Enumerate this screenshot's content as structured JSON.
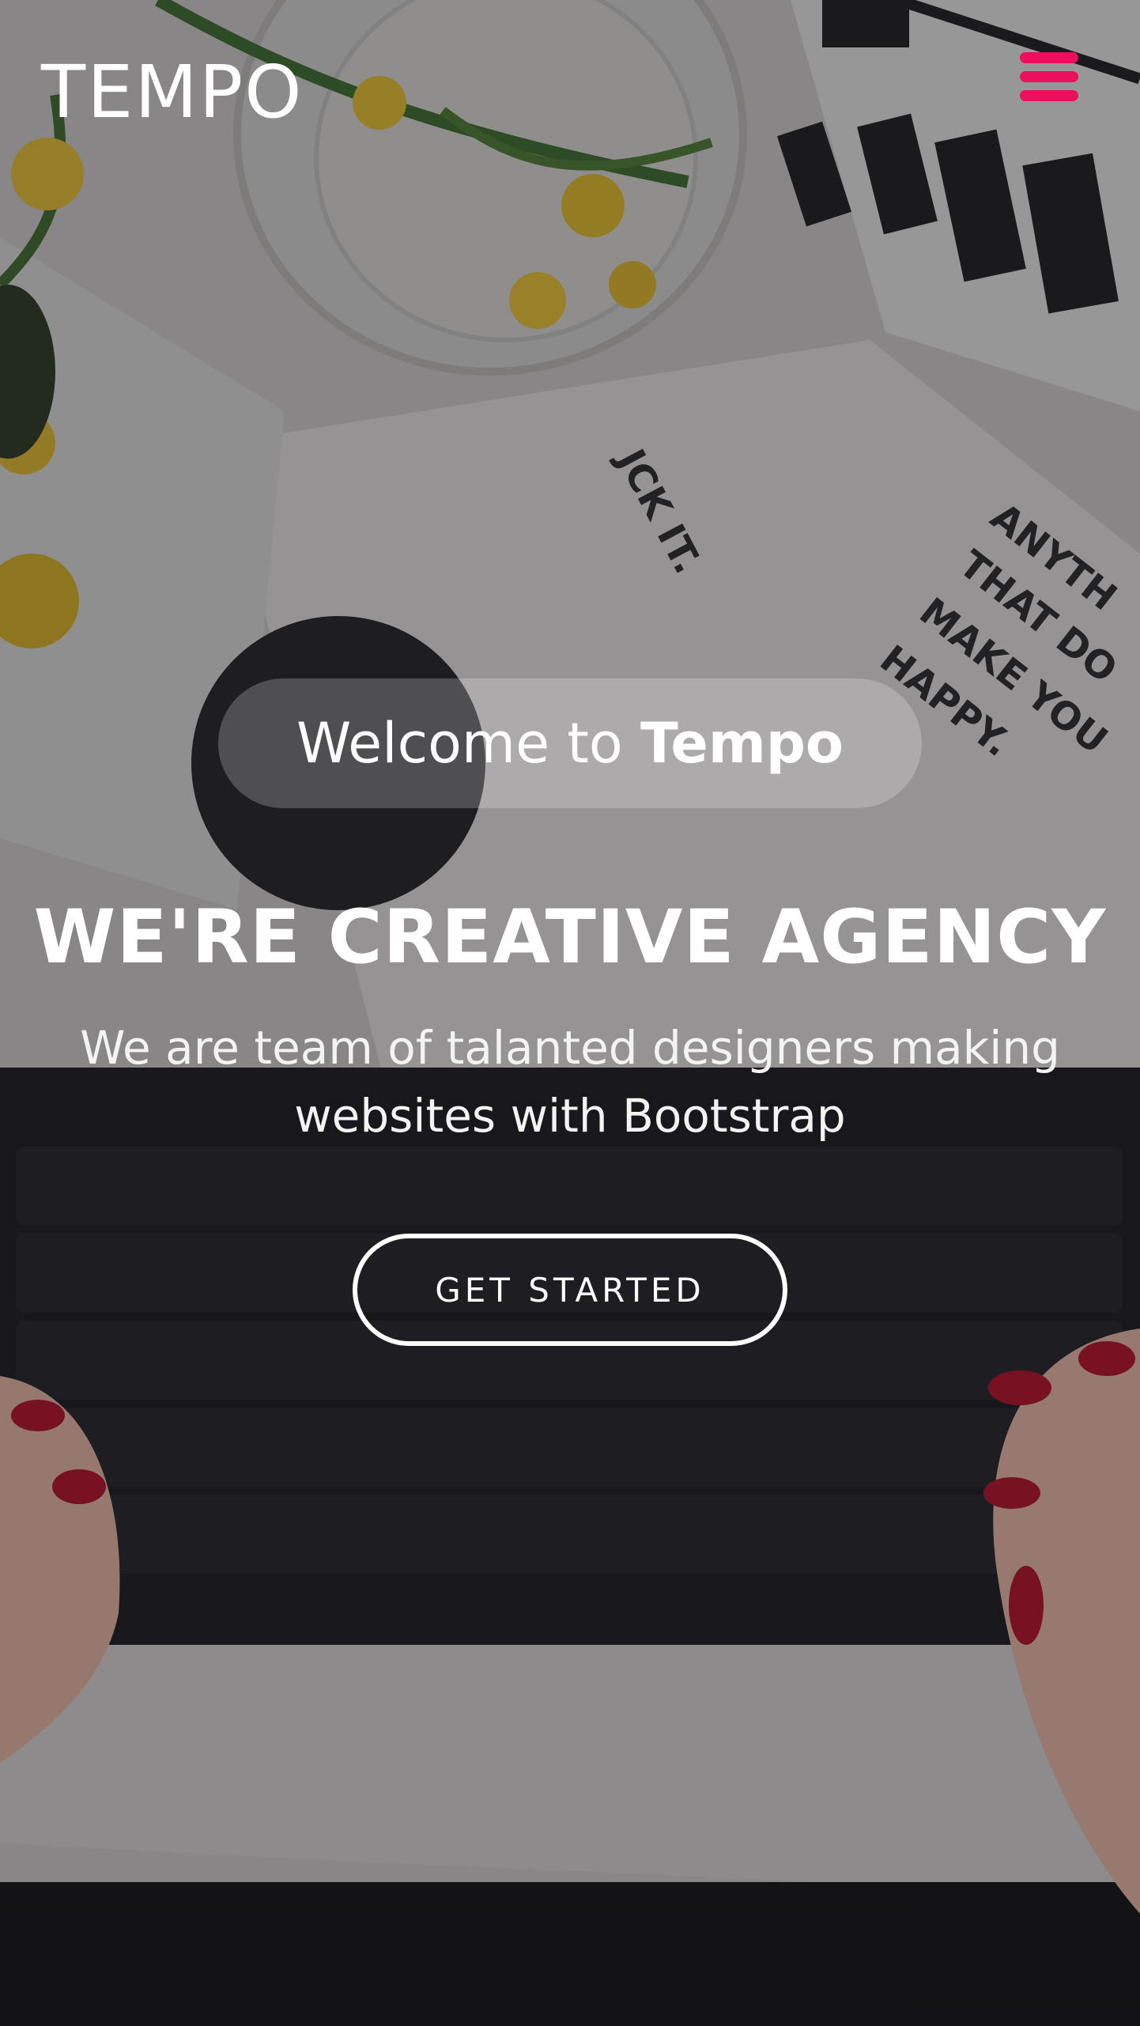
{
  "header": {
    "brand": "TEMPO",
    "menu_icon": "hamburger-menu-icon",
    "menu_color": "#ec0f5c"
  },
  "hero": {
    "welcome_prefix": "Welcome to ",
    "welcome_brand": "Tempo",
    "title": "WE'RE CREATIVE AGENCY",
    "subtitle": "We are team of talanted designers making websites with Bootstrap",
    "cta_label": "GET STARTED"
  },
  "colors": {
    "accent": "#ec0f5c",
    "text": "#ffffff"
  }
}
